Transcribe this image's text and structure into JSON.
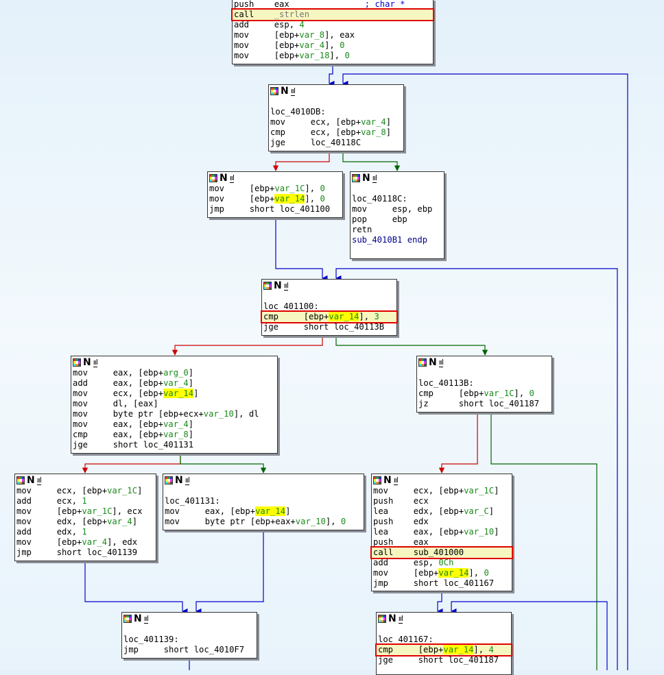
{
  "view": "IDA Pro graph view",
  "colors": {
    "edge_true": "#006400",
    "edge_false": "#cc0000",
    "edge_jump": "#0000cc",
    "highlight_box": "#e00000",
    "var_highlight": "#ffff00",
    "operand": "#1a8a1a"
  },
  "node_icons": [
    "graph-colors-icon",
    "n-toggle-icon",
    "chart-icon"
  ],
  "blocks": [
    {
      "id": "b0",
      "header": false,
      "lines": [
        [
          {
            "t": "push    eax",
            "c": ""
          },
          {
            "t": "               ; char *",
            "c": "cmt"
          }
        ],
        [
          {
            "t": "call    ",
            "c": "",
            "box": true
          },
          {
            "t": "_strlen",
            "c": "muted"
          }
        ],
        [
          {
            "t": "add     esp, ",
            "c": ""
          },
          {
            "t": "4",
            "c": "num"
          }
        ],
        [
          {
            "t": "mov     [ebp+",
            "c": ""
          },
          {
            "t": "var_8",
            "c": "var"
          },
          {
            "t": "], eax",
            "c": ""
          }
        ],
        [
          {
            "t": "mov     [ebp+",
            "c": ""
          },
          {
            "t": "var_4",
            "c": "var"
          },
          {
            "t": "], ",
            "c": ""
          },
          {
            "t": "0",
            "c": "num"
          }
        ],
        [
          {
            "t": "mov     [ebp+",
            "c": ""
          },
          {
            "t": "var_18",
            "c": "var"
          },
          {
            "t": "], ",
            "c": ""
          },
          {
            "t": "0",
            "c": "num"
          }
        ]
      ]
    },
    {
      "id": "b1",
      "header": true,
      "gap": true,
      "lines": [
        [
          {
            "t": "loc_4010DB:",
            "c": ""
          }
        ],
        [
          {
            "t": "mov     ecx, [ebp+",
            "c": ""
          },
          {
            "t": "var_4",
            "c": "var"
          },
          {
            "t": "]",
            "c": ""
          }
        ],
        [
          {
            "t": "cmp     ecx, [ebp+",
            "c": ""
          },
          {
            "t": "var_8",
            "c": "var"
          },
          {
            "t": "]",
            "c": ""
          }
        ],
        [
          {
            "t": "jge     loc_40118C",
            "c": ""
          }
        ]
      ]
    },
    {
      "id": "b2",
      "header": true,
      "gap": false,
      "lines": [
        [
          {
            "t": "mov     [ebp+",
            "c": ""
          },
          {
            "t": "var_1C",
            "c": "var"
          },
          {
            "t": "], ",
            "c": ""
          },
          {
            "t": "0",
            "c": "num"
          }
        ],
        [
          {
            "t": "mov     [ebp+",
            "c": ""
          },
          {
            "t": "var_14",
            "c": "var hl"
          },
          {
            "t": "], ",
            "c": ""
          },
          {
            "t": "0",
            "c": "num"
          }
        ],
        [
          {
            "t": "jmp     short loc_401100",
            "c": ""
          }
        ]
      ]
    },
    {
      "id": "b3",
      "header": true,
      "gap": true,
      "lines": [
        [
          {
            "t": "loc_40118C:",
            "c": ""
          }
        ],
        [
          {
            "t": "mov     esp, ebp",
            "c": ""
          }
        ],
        [
          {
            "t": "pop     ebp",
            "c": ""
          }
        ],
        [
          {
            "t": "retn",
            "c": ""
          }
        ],
        [
          {
            "t": "sub_4010B1 endp",
            "c": "endp"
          }
        ]
      ]
    },
    {
      "id": "b4",
      "header": true,
      "gap": true,
      "lines": [
        [
          {
            "t": "loc_401100:",
            "c": ""
          }
        ],
        [
          {
            "t": "cmp     [ebp+",
            "c": "",
            "box": true
          },
          {
            "t": "var_14",
            "c": "var hl"
          },
          {
            "t": "], ",
            "c": ""
          },
          {
            "t": "3",
            "c": "num"
          }
        ],
        [
          {
            "t": "jge     short loc_40113B",
            "c": ""
          }
        ]
      ]
    },
    {
      "id": "b5",
      "header": true,
      "gap": false,
      "lines": [
        [
          {
            "t": "mov     eax, [ebp+",
            "c": ""
          },
          {
            "t": "arg_0",
            "c": "var"
          },
          {
            "t": "]",
            "c": ""
          }
        ],
        [
          {
            "t": "add     eax, [ebp+",
            "c": ""
          },
          {
            "t": "var_4",
            "c": "var"
          },
          {
            "t": "]",
            "c": ""
          }
        ],
        [
          {
            "t": "mov     ecx, [ebp+",
            "c": ""
          },
          {
            "t": "var_14",
            "c": "var hl"
          },
          {
            "t": "]",
            "c": ""
          }
        ],
        [
          {
            "t": "mov     dl, [eax]",
            "c": ""
          }
        ],
        [
          {
            "t": "mov     byte ptr [ebp+ecx+",
            "c": ""
          },
          {
            "t": "var_10",
            "c": "var"
          },
          {
            "t": "], dl",
            "c": ""
          }
        ],
        [
          {
            "t": "mov     eax, [ebp+",
            "c": ""
          },
          {
            "t": "var_4",
            "c": "var"
          },
          {
            "t": "]",
            "c": ""
          }
        ],
        [
          {
            "t": "cmp     eax, [ebp+",
            "c": ""
          },
          {
            "t": "var_8",
            "c": "var"
          },
          {
            "t": "]",
            "c": ""
          }
        ],
        [
          {
            "t": "jge     short loc_401131",
            "c": ""
          }
        ]
      ]
    },
    {
      "id": "b6",
      "header": true,
      "gap": true,
      "lines": [
        [
          {
            "t": "loc_40113B:",
            "c": ""
          }
        ],
        [
          {
            "t": "cmp     [ebp+",
            "c": ""
          },
          {
            "t": "var_1C",
            "c": "var"
          },
          {
            "t": "], ",
            "c": ""
          },
          {
            "t": "0",
            "c": "num"
          }
        ],
        [
          {
            "t": "jz      short loc_401187",
            "c": ""
          }
        ]
      ]
    },
    {
      "id": "b7",
      "header": true,
      "gap": false,
      "lines": [
        [
          {
            "t": "mov     ecx, [ebp+",
            "c": ""
          },
          {
            "t": "var_1C",
            "c": "var"
          },
          {
            "t": "]",
            "c": ""
          }
        ],
        [
          {
            "t": "add     ecx, ",
            "c": ""
          },
          {
            "t": "1",
            "c": "num"
          }
        ],
        [
          {
            "t": "mov     [ebp+",
            "c": ""
          },
          {
            "t": "var_1C",
            "c": "var"
          },
          {
            "t": "], ecx",
            "c": ""
          }
        ],
        [
          {
            "t": "mov     edx, [ebp+",
            "c": ""
          },
          {
            "t": "var_4",
            "c": "var"
          },
          {
            "t": "]",
            "c": ""
          }
        ],
        [
          {
            "t": "add     edx, ",
            "c": ""
          },
          {
            "t": "1",
            "c": "num"
          }
        ],
        [
          {
            "t": "mov     [ebp+",
            "c": ""
          },
          {
            "t": "var_4",
            "c": "var"
          },
          {
            "t": "], edx",
            "c": ""
          }
        ],
        [
          {
            "t": "jmp     short loc_401139",
            "c": ""
          }
        ]
      ]
    },
    {
      "id": "b8",
      "header": true,
      "gap": true,
      "lines": [
        [
          {
            "t": "loc_401131:",
            "c": ""
          }
        ],
        [
          {
            "t": "mov     eax, [ebp+",
            "c": ""
          },
          {
            "t": "var_14",
            "c": "var hl"
          },
          {
            "t": "]",
            "c": ""
          }
        ],
        [
          {
            "t": "mov     byte ptr [ebp+eax+",
            "c": ""
          },
          {
            "t": "var_10",
            "c": "var"
          },
          {
            "t": "], ",
            "c": ""
          },
          {
            "t": "0",
            "c": "num"
          }
        ]
      ]
    },
    {
      "id": "b9",
      "header": true,
      "gap": false,
      "lines": [
        [
          {
            "t": "mov     ecx, [ebp+",
            "c": ""
          },
          {
            "t": "var_1C",
            "c": "var"
          },
          {
            "t": "]",
            "c": ""
          }
        ],
        [
          {
            "t": "push    ecx",
            "c": ""
          }
        ],
        [
          {
            "t": "lea     edx, [ebp+",
            "c": ""
          },
          {
            "t": "var_C",
            "c": "var"
          },
          {
            "t": "]",
            "c": ""
          }
        ],
        [
          {
            "t": "push    edx",
            "c": ""
          }
        ],
        [
          {
            "t": "lea     eax, [ebp+",
            "c": ""
          },
          {
            "t": "var_10",
            "c": "var"
          },
          {
            "t": "]",
            "c": ""
          }
        ],
        [
          {
            "t": "push    eax",
            "c": ""
          }
        ],
        [
          {
            "t": "call    sub_401000",
            "c": "",
            "box": true
          }
        ],
        [
          {
            "t": "add     esp, ",
            "c": ""
          },
          {
            "t": "0Ch",
            "c": "num"
          }
        ],
        [
          {
            "t": "mov     [ebp+",
            "c": ""
          },
          {
            "t": "var_14",
            "c": "var hl"
          },
          {
            "t": "], ",
            "c": ""
          },
          {
            "t": "0",
            "c": "num"
          }
        ],
        [
          {
            "t": "jmp     short loc_401167",
            "c": ""
          }
        ]
      ]
    },
    {
      "id": "b10",
      "header": true,
      "gap": true,
      "lines": [
        [
          {
            "t": "loc_401139:",
            "c": ""
          }
        ],
        [
          {
            "t": "jmp     short loc_4010F7",
            "c": ""
          }
        ]
      ]
    },
    {
      "id": "b11",
      "header": true,
      "gap": true,
      "lines": [
        [
          {
            "t": "loc_401167:",
            "c": ""
          }
        ],
        [
          {
            "t": "cmp     [ebp+",
            "c": "",
            "box": true
          },
          {
            "t": "var_14",
            "c": "var hl"
          },
          {
            "t": "], ",
            "c": ""
          },
          {
            "t": "4",
            "c": "num"
          }
        ],
        [
          {
            "t": "jge     short loc_401187",
            "c": ""
          }
        ]
      ]
    }
  ]
}
